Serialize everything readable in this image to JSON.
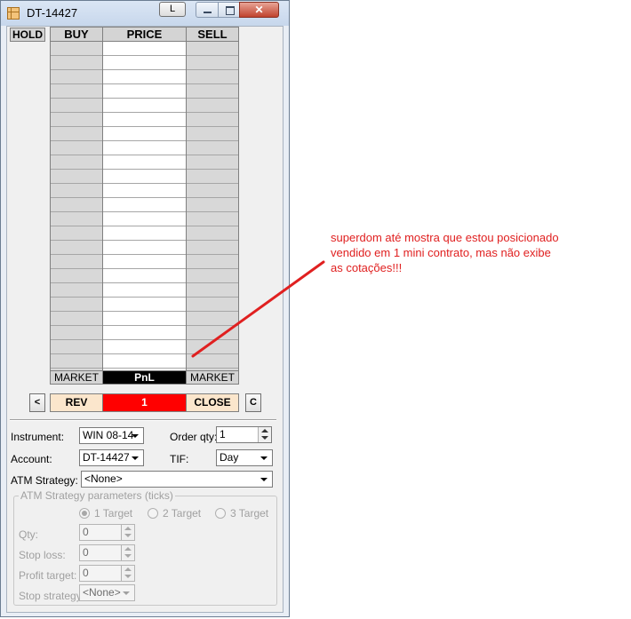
{
  "window": {
    "title": "DT-14427",
    "l_button": "L"
  },
  "ladder": {
    "hold_header": "HOLD",
    "headers": {
      "buy": "BUY",
      "price": "PRICE",
      "sell": "SELL"
    },
    "footer": {
      "buy_market": "MARKET",
      "pnl": "PnL",
      "sell_market": "MARKET"
    }
  },
  "actions": {
    "prev": "<",
    "rev": "REV",
    "position_qty": "1",
    "close": "CLOSE",
    "c": "C"
  },
  "form": {
    "instrument_label": "Instrument:",
    "instrument_value": "WIN 08-14",
    "order_qty_label": "Order qty:",
    "order_qty_value": "1",
    "account_label": "Account:",
    "account_value": "DT-14427",
    "tif_label": "TIF:",
    "tif_value": "Day",
    "atm_label": "ATM Strategy:",
    "atm_value": "<None>"
  },
  "atm_params": {
    "title": "ATM Strategy parameters (ticks)",
    "target1": "1 Target",
    "target2": "2 Target",
    "target3": "3 Target",
    "qty_label": "Qty:",
    "qty_value": "0",
    "stop_loss_label": "Stop loss:",
    "stop_loss_value": "0",
    "profit_target_label": "Profit target:",
    "profit_target_value": "0",
    "stop_strategy_label": "Stop strategy:",
    "stop_strategy_value": "<None>"
  },
  "annotation": {
    "line1": "superdom até mostra que estou posicionado",
    "line2": "vendido em 1 mini contrato, mas não exibe",
    "line3": "as cotações!!!",
    "color": "#e02020"
  }
}
